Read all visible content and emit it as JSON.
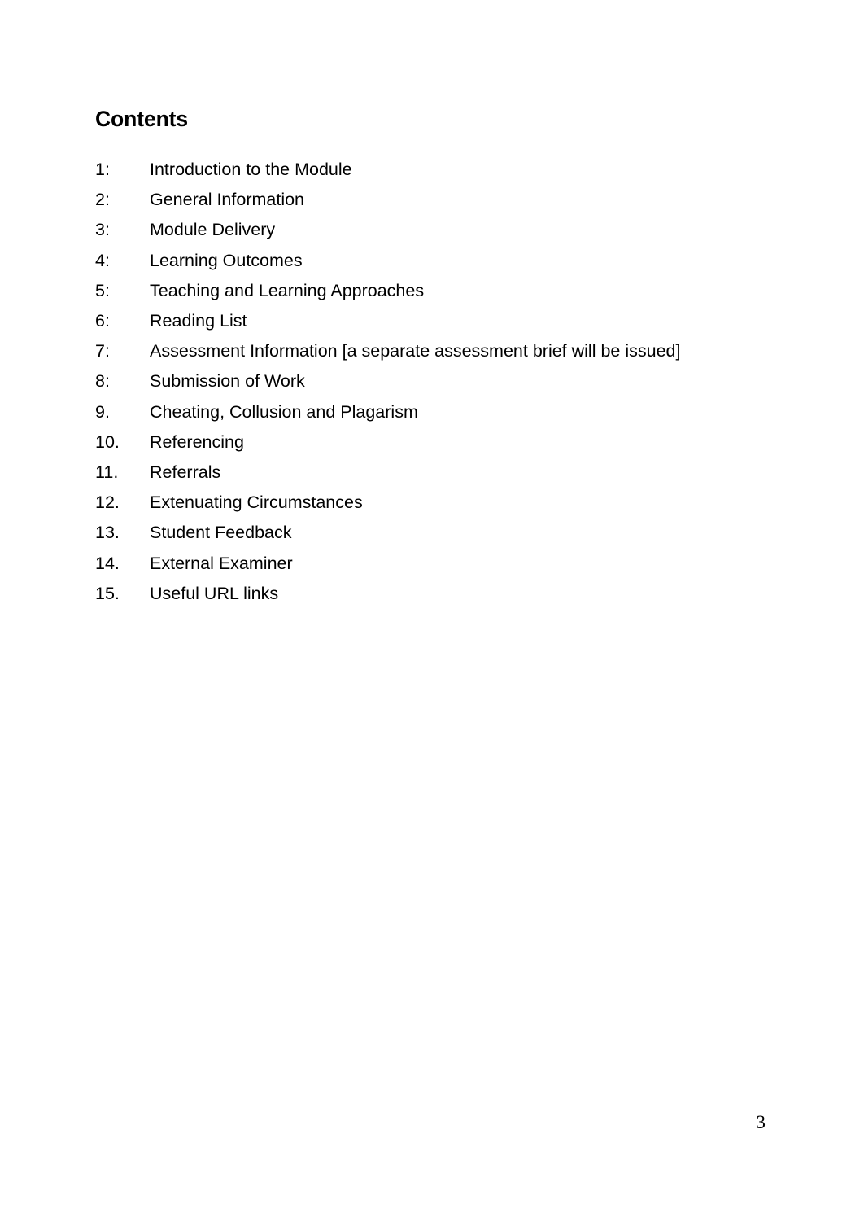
{
  "document": {
    "heading": "Contents",
    "page_number": "3",
    "text_color": "#000000",
    "background_color": "#ffffff"
  },
  "toc": {
    "items": [
      {
        "number": "1:",
        "label": "Introduction to the Module"
      },
      {
        "number": "2:",
        "label": "General Information"
      },
      {
        "number": "3:",
        "label": "Module Delivery"
      },
      {
        "number": "4:",
        "label": "Learning Outcomes"
      },
      {
        "number": "5:",
        "label": "Teaching and Learning Approaches"
      },
      {
        "number": "6:",
        "label": "Reading List"
      },
      {
        "number": "7:",
        "label": "Assessment Information [a separate assessment brief will be issued]"
      },
      {
        "number": "8:",
        "label": "Submission of Work"
      },
      {
        "number": "9.",
        "label": "Cheating, Collusion and Plagarism"
      },
      {
        "number": "10.",
        "label": "Referencing"
      },
      {
        "number": "11.",
        "label": "Referrals"
      },
      {
        "number": "12.",
        "label": "Extenuating Circumstances"
      },
      {
        "number": "13.",
        "label": "Student Feedback"
      },
      {
        "number": "14.",
        "label": "External Examiner"
      },
      {
        "number": "15.",
        "label": "Useful URL links"
      }
    ]
  }
}
